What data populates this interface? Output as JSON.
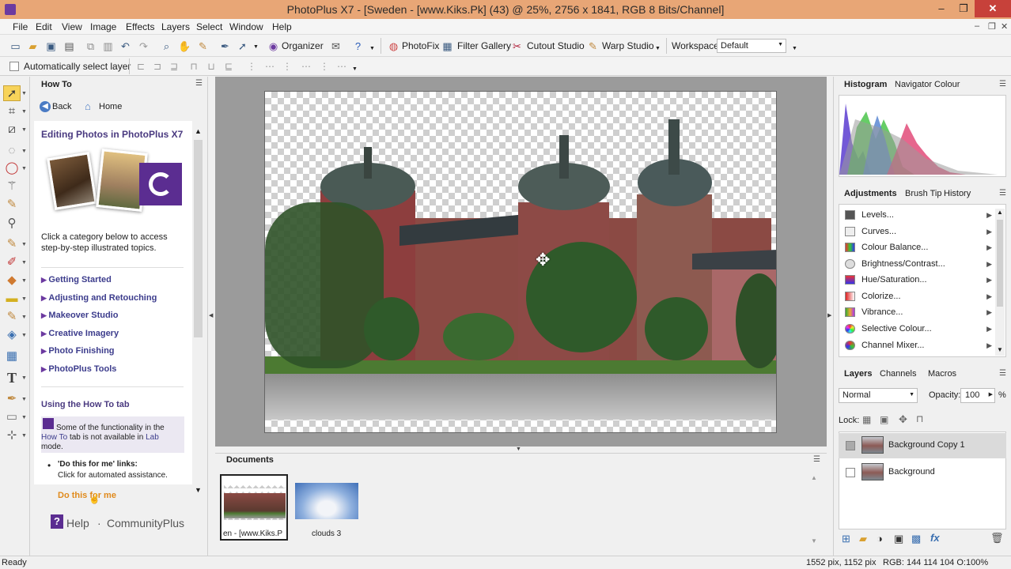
{
  "window": {
    "title": "PhotoPlus X7 - [Sweden - [www.Kiks.Pk] (43) @ 25%, 2756 x 1841, RGB 8 Bits/Channel]",
    "minimize": "–",
    "restore": "❐",
    "close": "✕"
  },
  "menu": {
    "items": [
      "File",
      "Edit",
      "View",
      "Image",
      "Effects",
      "Layers",
      "Select",
      "Window",
      "Help"
    ],
    "doc_minimize": "–",
    "doc_restore": "❐",
    "doc_close": "✕"
  },
  "toolbar": {
    "organizer": "Organizer",
    "photofix": "PhotoFix",
    "filter_gallery": "Filter Gallery",
    "cutout_studio": "Cutout Studio",
    "warp_studio": "Warp Studio",
    "workspace_label": "Workspace",
    "workspace_value": "Default"
  },
  "context_bar": {
    "auto_select_label": "Automatically select layer"
  },
  "howto": {
    "tab_label": "How To",
    "back": "Back",
    "home": "Home",
    "heading": "Editing Photos in PhotoPlus X7",
    "intro": "Click a category below to access step-by-step illustrated topics.",
    "categories": [
      "Getting Started",
      "Adjusting and Retouching",
      "Makeover Studio",
      "Creative Imagery",
      "Photo Finishing",
      "PhotoPlus Tools"
    ],
    "using_title": "Using the How To tab",
    "note_pre": "Some of the functionality in the ",
    "note_link": "How To",
    "note_mid": " tab is not available in ",
    "note_link2": "Lab",
    "note_post": " mode.",
    "bullet_title": "'Do this for me' links:",
    "bullet_text": "Click for automated assistance.",
    "do_this": "Do this for me",
    "help": "Help",
    "dot": "·",
    "community": "CommunityPlus"
  },
  "documents": {
    "title": "Documents",
    "items": [
      {
        "label": "en - [www.Kiks.P"
      },
      {
        "label": "clouds 3"
      }
    ]
  },
  "histogram_tabs": [
    "Histogram",
    "Navigator",
    "Colour"
  ],
  "adjustments": {
    "tabs": [
      "Adjustments",
      "Brush Tip",
      "History"
    ],
    "items": [
      "Levels...",
      "Curves...",
      "Colour Balance...",
      "Brightness/Contrast...",
      "Hue/Saturation...",
      "Colorize...",
      "Vibrance...",
      "Selective Colour...",
      "Channel Mixer..."
    ]
  },
  "layers": {
    "tabs": [
      "Layers",
      "Channels",
      "Macros"
    ],
    "blend_mode": "Normal",
    "opacity_label": "Opacity:",
    "opacity_value": "100",
    "opacity_unit": "%",
    "lock_label": "Lock:",
    "items": [
      {
        "name": "Background Copy 1"
      },
      {
        "name": "Background"
      }
    ]
  },
  "status": {
    "ready": "Ready",
    "size": "1552 pix, 1152 pix",
    "rgb": "RGB: 144 114 104 O:100%"
  },
  "colors": {
    "titlebar": "#e8a676",
    "close": "#c7413a",
    "accent_purple": "#6c3aa0",
    "link": "#3c3c8c",
    "orange_link": "#e08a1c"
  }
}
